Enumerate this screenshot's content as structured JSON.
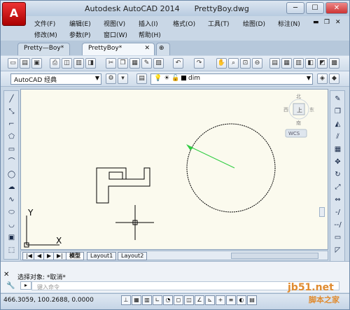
{
  "app": {
    "logo_letter": "A",
    "title": "Autodesk AutoCAD 2014",
    "filename": "PrettyBoy.dwg"
  },
  "menus": {
    "row1": [
      "文件(F)",
      "编辑(E)",
      "视图(V)",
      "插入(I)",
      "格式(O)",
      "工具(T)",
      "绘图(D)",
      "标注(N)"
    ],
    "row2": [
      "修改(M)",
      "参数(P)",
      "窗口(W)",
      "帮助(H)"
    ]
  },
  "doc_tabs": [
    {
      "label": "Pretty—Boy*",
      "close": ""
    },
    {
      "label": "PrettyBoy*",
      "close": "✕"
    }
  ],
  "toolbar": {
    "workspace": "AutoCAD 经典",
    "layer": "dim"
  },
  "viewcube": {
    "north": "北",
    "south": "南",
    "west": "西",
    "east": "东",
    "top": "上",
    "wcs": "WCS"
  },
  "layout_tabs": [
    "模型",
    "Layout1",
    "Layout2"
  ],
  "command": {
    "history": "选择对象: *取消*",
    "placeholder": "键入命令"
  },
  "status": {
    "coords": "466.3059, 100.2688, 0.0000"
  },
  "watermark": {
    "site": "jb51.net",
    "name": "脚本之家"
  },
  "colors": {
    "canvas": "#fbfaee",
    "accent": "#c0392b",
    "green_line": "#2ecc40"
  }
}
